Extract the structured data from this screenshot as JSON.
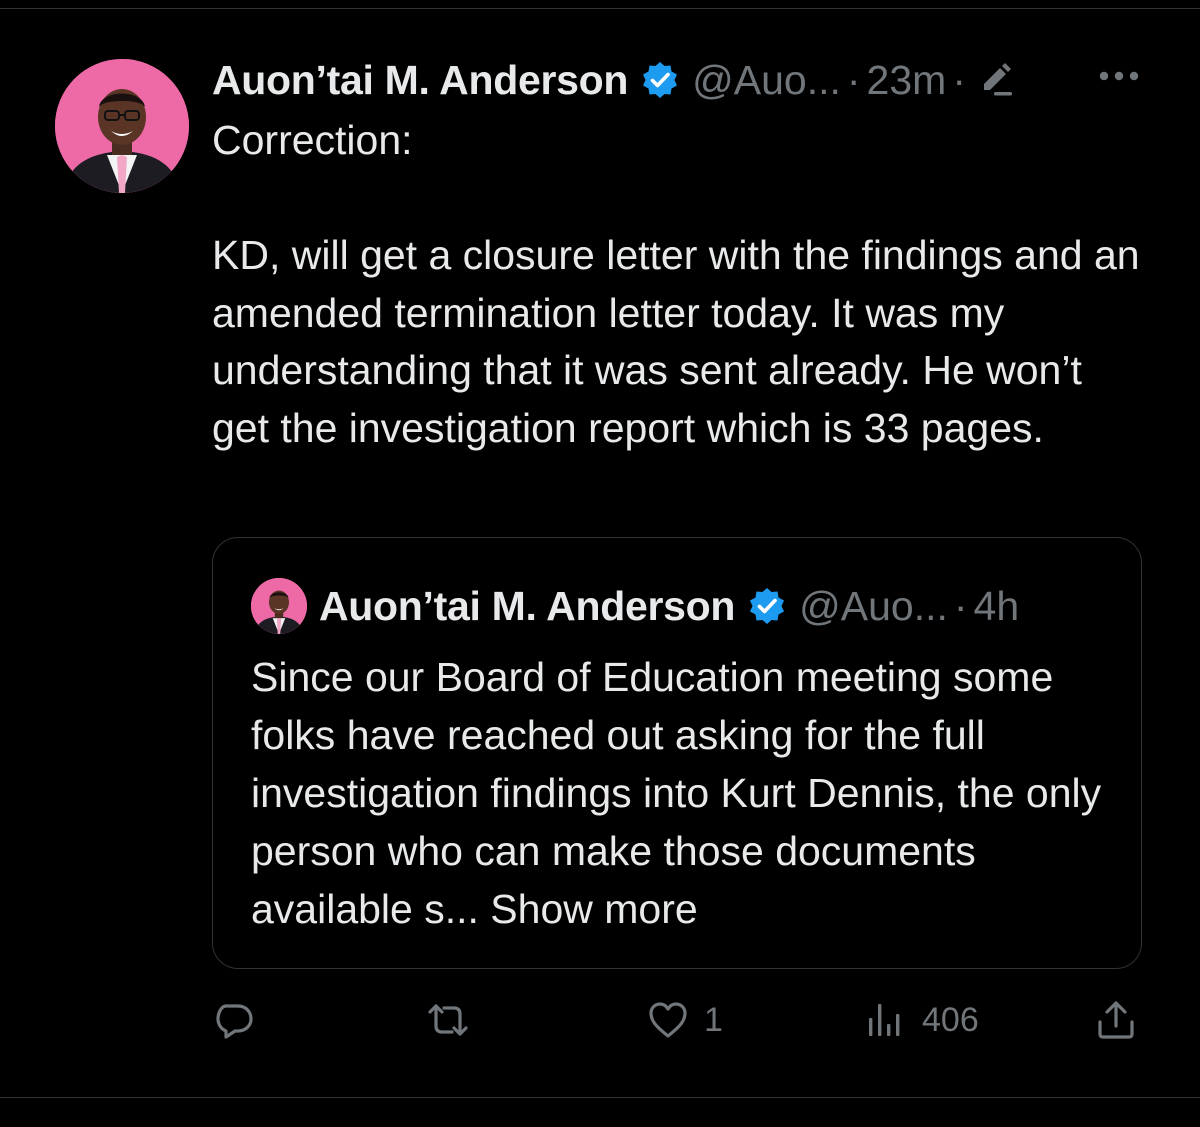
{
  "tweet": {
    "author_name": "Auon’tai M. Anderson",
    "handle": "@Auo...",
    "separator": "·",
    "time": "23m",
    "text": "Correction:\n\nKD, will get a closure letter with the findings and an amended termination letter today. It was my understanding that it was sent already. He won’t get the investigation report which is 33 pages.",
    "icons": {
      "verified": "verified-badge-icon",
      "edited": "edit-pencil-icon",
      "more": "more-options-icon"
    }
  },
  "quoted_tweet": {
    "author_name": "Auon’tai M. Anderson",
    "handle": "@Auo...",
    "separator": "·",
    "time": "4h",
    "text": "Since our Board of Education meeting some folks have reached out asking for the full investigation findings into Kurt Dennis, the only person who can make those documents available s... ",
    "show_more": "Show more"
  },
  "actions": {
    "reply_count": "",
    "retweet_count": "",
    "like_count": "1",
    "views_count": "406"
  },
  "colors": {
    "background": "#000000",
    "text": "#e7e9ea",
    "muted": "#71767b",
    "verified_blue": "#1d9bf0",
    "border": "#2f3336",
    "avatar_pink": "#ee6aa7"
  }
}
